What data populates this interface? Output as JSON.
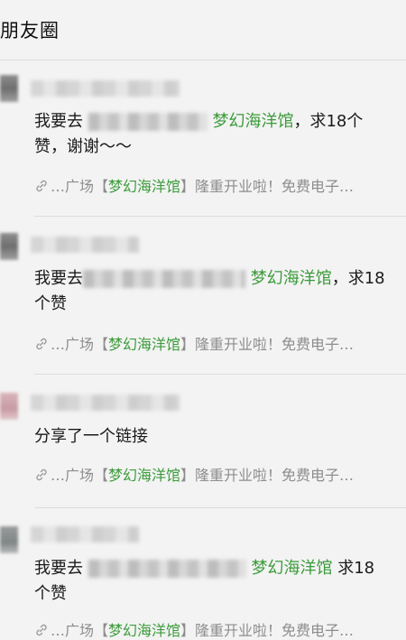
{
  "header": {
    "title": "朋友圈"
  },
  "link_preview": {
    "prefix": "…广场【",
    "green": "梦幻海洋馆",
    "suffix": "】隆重开业啦！免费电子…"
  },
  "posts": [
    {
      "line1_start": "我要去",
      "place": "梦幻海洋馆",
      "line1_end": "，求18个",
      "line2": "赞，谢谢～～"
    },
    {
      "line1_start": "我要去",
      "place": "梦幻海洋馆",
      "line1_end": "，求18",
      "line2": "个赞"
    },
    {
      "line1_start": "分享了一个链接"
    },
    {
      "line1_start": "我要去",
      "place": "梦幻海洋馆",
      "line1_end": " 求18",
      "line2": "个赞"
    }
  ],
  "colors": {
    "accent_green": "#3b9b3b",
    "muted": "#8d8d8d"
  }
}
